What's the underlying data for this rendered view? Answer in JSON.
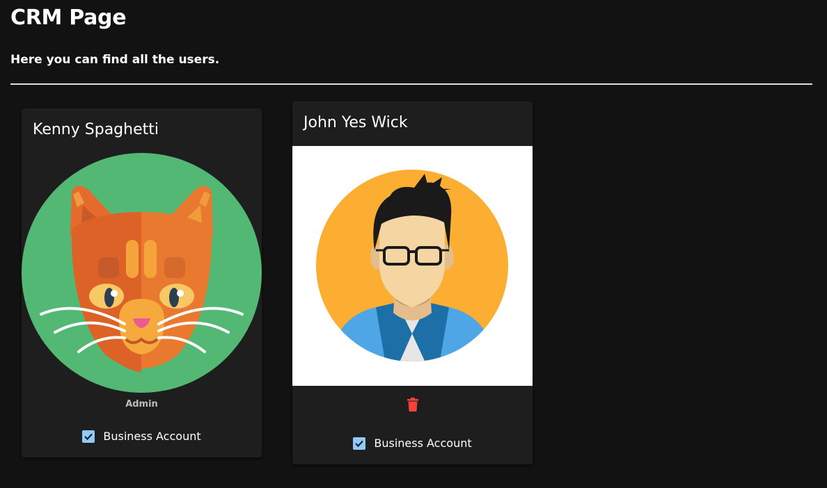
{
  "page": {
    "title": "CRM Page",
    "subtitle": "Here you can find all the users."
  },
  "users": [
    {
      "name": "Kenny Spaghetti",
      "avatar": "cat-avatar",
      "role": "Admin",
      "business_account_label": "Business Account",
      "business_account_checked": true
    },
    {
      "name": "John Yes Wick",
      "avatar": "man-with-glasses-avatar",
      "delete_icon": "trash-icon",
      "business_account_label": "Business Account",
      "business_account_checked": true
    }
  ],
  "colors": {
    "background": "#121212",
    "card": "#1e1e1e",
    "checkbox": "#90caf9",
    "delete": "#f44336",
    "cat_bg": "#52b874",
    "man_bg": "#fbae32"
  }
}
